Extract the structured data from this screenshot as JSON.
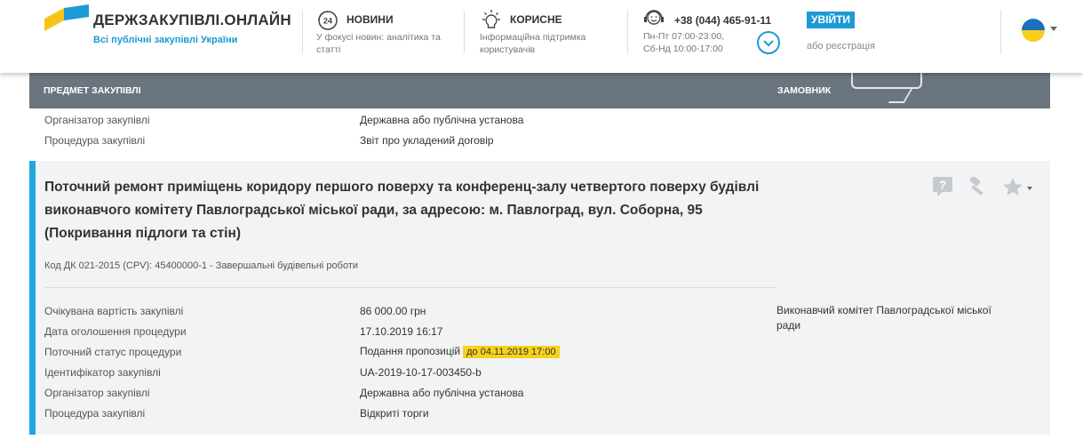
{
  "header": {
    "logo_title": "ДЕРЖЗАКУПІВЛІ.ОНЛАЙН",
    "logo_subtitle": "Всі публічні закупівлі України",
    "news": {
      "title": "НОВИНИ",
      "desc_1": "У фокусі новин: аналітика та",
      "desc_2": "статті",
      "icon": "news-24-icon"
    },
    "useful": {
      "title": "КОРИСНЕ",
      "desc_1": "Інформаційна підтримка",
      "desc_2": "користувачів",
      "icon": "lightbulb-icon"
    },
    "phone": {
      "number": "+38 (044) 465-91-11",
      "hours_1": "Пн-Пт 07:00-23:00,",
      "hours_2": "Сб-Нд 10:00-17:00",
      "icon": "headset-icon"
    },
    "login_label": "УВІЙТИ",
    "register_label": "або реєстрація",
    "lang_icon": "ukraine-flag-icon"
  },
  "table_header": {
    "subject": "ПРЕДМЕТ ЗАКУПІВЛІ",
    "customer": "ЗАМОВНИК"
  },
  "previous_row": {
    "organizer_label": "Організатор закупівлі",
    "organizer_value": "Державна або публічна установа",
    "procedure_label": "Процедура закупівлі",
    "procedure_value": "Звіт про укладений договір"
  },
  "tender": {
    "title_1": "Поточний ремонт приміщень коридору першого поверху та конференц-залу четвертого поверху будівлі",
    "title_2": "виконавчого комітету Павлоградської міської ради, за адресою: м. Павлоград, вул. Соборна, 95",
    "title_3": "(Покривання підлоги та стін)",
    "cpv": "Код ДК 021-2015 (CPV): 45400000-1 - Завершальні будівельні роботи",
    "customer_1": "Виконавчий комітет Павлоградської міської",
    "customer_2": "ради",
    "fields": [
      {
        "label": "Очікувана вартість закупівлі",
        "value": "86 000.00 грн"
      },
      {
        "label": "Дата оголошення процедури",
        "value": "17.10.2019 16:17"
      },
      {
        "label": "Поточний статус процедури",
        "value": "Подання пропозицій"
      },
      {
        "label": "Ідентифікатор закупівлі",
        "value": "UA-2019-10-17-003450-b"
      },
      {
        "label": "Організатор закупівлі",
        "value": "Державна або публічна установа"
      },
      {
        "label": "Процедура закупівлі",
        "value": "Відкриті торги"
      }
    ],
    "deadline": "до 04.11.2019 17:00",
    "accent_color": "#1ea8e0",
    "deadline_color": "#f6d21e"
  },
  "actions": {
    "question_icon": "question-icon",
    "gavel_icon": "gavel-icon",
    "star_icon": "star-icon"
  }
}
